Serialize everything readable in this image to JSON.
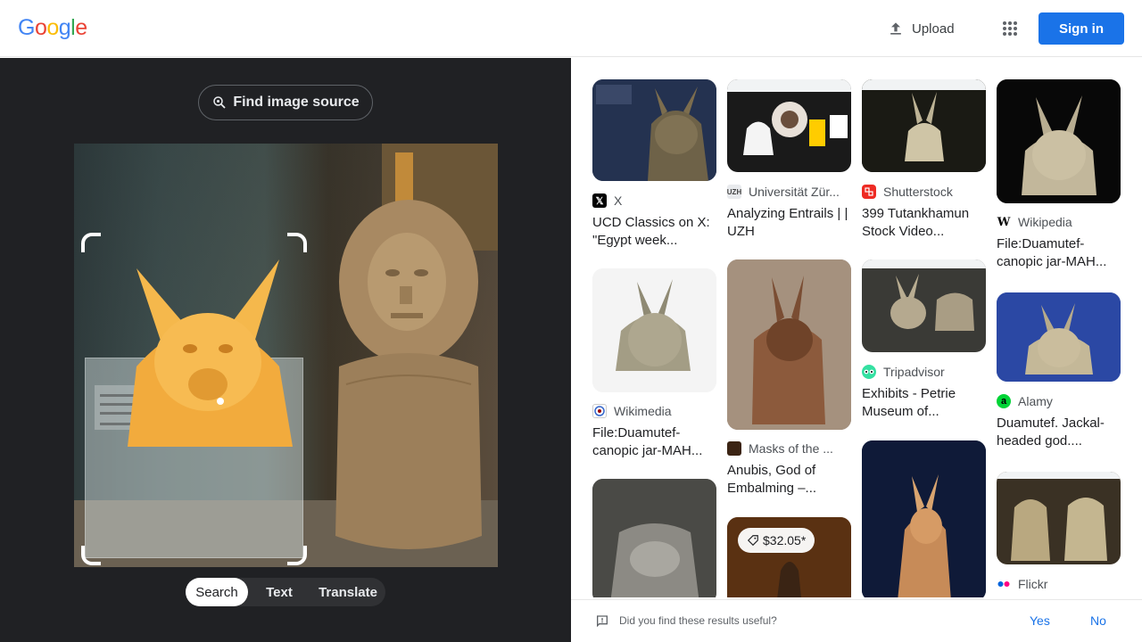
{
  "header": {
    "logo_letters": [
      "G",
      "o",
      "o",
      "g",
      "l",
      "e"
    ],
    "logo_colors": [
      "#4285F4",
      "#EA4335",
      "#FBBC05",
      "#4285F4",
      "#34A853",
      "#EA4335"
    ],
    "upload_label": "Upload",
    "signin_label": "Sign in"
  },
  "lens": {
    "find_source_label": "Find image source",
    "modes": [
      {
        "label": "Search",
        "active": true
      },
      {
        "label": "Text",
        "active": false
      },
      {
        "label": "Translate",
        "active": false
      }
    ]
  },
  "results": [
    {
      "source": "X",
      "title": "UCD Classics on X: \"Egypt week...",
      "favicon": "x-icon",
      "favicon_color": "#000000"
    },
    {
      "source": "Universität Zür...",
      "title": "Analyzing Entrails | | UZH",
      "favicon": "uzh-icon",
      "favicon_color": "#e8eaed"
    },
    {
      "source": "Shutterstock",
      "title": "399 Tutankhamun Stock Video...",
      "favicon": "shutterstock-icon",
      "favicon_color": "#ee2b24"
    },
    {
      "source": "Wikipedia",
      "title": "File:Duamutef-canopic jar-MAH...",
      "favicon": "wikipedia-icon",
      "favicon_color": "#ffffff"
    },
    {
      "source": "Wikimedia",
      "title": "File:Duamutef-canopic jar-MAH...",
      "favicon": "wikimedia-icon",
      "favicon_color": "#ffffff"
    },
    {
      "source": "Masks of the ...",
      "title": "Anubis, God of Embalming –...",
      "favicon": "masks-icon",
      "favicon_color": "#3b2414"
    },
    {
      "source": "Tripadvisor",
      "title": "Exhibits - Petrie Museum of...",
      "favicon": "tripadvisor-icon",
      "favicon_color": "#34e0a1"
    },
    {
      "source": "Alamy",
      "title": "Duamutef. Jackal-headed god....",
      "favicon": "alamy-icon",
      "favicon_color": "#00d436"
    },
    {
      "source": "Flickr",
      "title": "",
      "favicon": "flickr-icon",
      "favicon_color": "#ffffff"
    }
  ],
  "price_tag": "$32.05*",
  "feedback": {
    "question": "Did you find these results useful?",
    "yes": "Yes",
    "no": "No"
  }
}
